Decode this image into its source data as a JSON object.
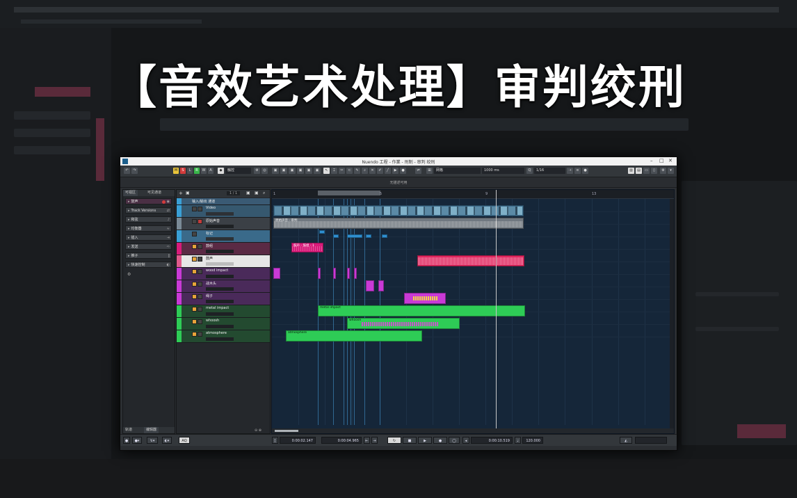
{
  "title_banner": "【音效艺术处理】审判绞刑",
  "window": {
    "title": "Nuendo 工程 - 作業 - 刑制 - 审判 绞刑",
    "subtitle": "无描述可用",
    "controls": [
      "–",
      "□",
      "✕"
    ]
  },
  "toolbar": {
    "m": "M",
    "s": "S",
    "l": "L",
    "r": "R",
    "w": "W",
    "a": "A",
    "mode": "触控",
    "grid": "网格",
    "grid_value": "1000 ms",
    "quantize": "1/16"
  },
  "inspector": {
    "tabs": [
      "可视区",
      "可见通道"
    ],
    "items": [
      {
        "label": "鼓声",
        "selected": true
      },
      {
        "label": "Track Versions"
      },
      {
        "label": "和弦"
      },
      {
        "label": "均衡器"
      },
      {
        "label": "插入"
      },
      {
        "label": "发送"
      },
      {
        "label": "推子"
      },
      {
        "label": "快速控制"
      }
    ],
    "bottom_tabs": [
      "轨道",
      "编辑器"
    ]
  },
  "tracklist": {
    "header_counter": "1 / 1",
    "tracks": [
      {
        "name": "输入/输出 通道",
        "color": "#3aa0d6"
      },
      {
        "name": "Video",
        "color": "#3aa0d6"
      },
      {
        "name": "原始声音",
        "color": "#3aa0d6"
      },
      {
        "name": "标记",
        "color": "#3aa0d6"
      },
      {
        "name": "鼓组",
        "color": "#d81b7a"
      },
      {
        "name": "鼓声",
        "color": "#e05a8c"
      },
      {
        "name": "wood impact",
        "color": "#c93ad6"
      },
      {
        "name": "战木头",
        "color": "#c93ad6"
      },
      {
        "name": "绳子",
        "color": "#c93ad6"
      },
      {
        "name": "metal impact",
        "color": "#2ecc56"
      },
      {
        "name": "whoosh",
        "color": "#2ecc56"
      },
      {
        "name": "atmosphere",
        "color": "#2ecc56"
      }
    ]
  },
  "ruler": {
    "bars": [
      "1",
      "5",
      "9",
      "13"
    ]
  },
  "events": {
    "video": "Video",
    "original": "原始声音 - 审判",
    "drum1": "鼓声 - 鼓组 - 1",
    "metal": "metal impact",
    "whoosh": "whoosh",
    "atmosphere": "atmosphere"
  },
  "transport": {
    "left_locator": "0:00:02.147",
    "right_locator": "0:00:04.965",
    "position": "0:00:10.519",
    "tempo": "120.000",
    "mode": "AQ"
  },
  "colors": {
    "arrange_bg": "#152639",
    "green": "#2ecc56",
    "pink": "#d81b7a",
    "magenta": "#c93ad6",
    "blue": "#3aa0d6"
  }
}
